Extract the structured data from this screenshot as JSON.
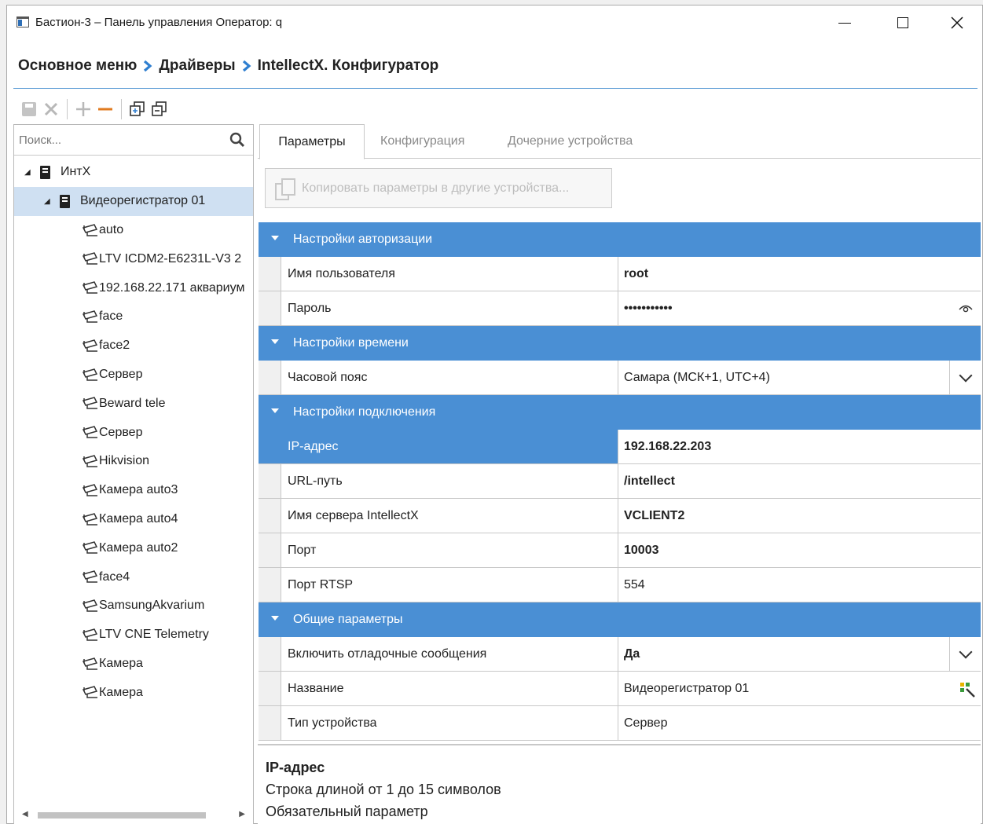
{
  "window": {
    "title": "Бастион-3 – Панель управления Оператор: q"
  },
  "breadcrumb": {
    "items": [
      "Основное меню",
      "Драйверы",
      "IntellectX. Конфигуратор"
    ]
  },
  "search": {
    "placeholder": "Поиск..."
  },
  "tree": {
    "root": "ИнтX",
    "device": "Видеорегистратор 01",
    "cameras": [
      "auto",
      "LTV ICDM2-E6231L-V3 2",
      "192.168.22.171 аквариум",
      "face",
      "face2",
      "Сервер",
      "Beward tele",
      "Сервер",
      "Hikvision",
      "Камера auto3",
      "Камера auto4",
      "Камера auto2",
      "face4",
      "SamsungAkvarium",
      "LTV CNE Telemetry",
      "Камера",
      "Камера"
    ]
  },
  "tabs": [
    "Параметры",
    "Конфигурация",
    "Дочерние устройства"
  ],
  "copy_button": "Копировать параметры в другие устройства...",
  "sections": {
    "auth": {
      "title": "Настройки авторизации",
      "username_label": "Имя пользователя",
      "username_value": "root",
      "password_label": "Пароль",
      "password_value": "•••••••••••"
    },
    "time": {
      "title": "Настройки времени",
      "tz_label": "Часовой пояс",
      "tz_value": "Самара (МСК+1, UTC+4)"
    },
    "connection": {
      "title": "Настройки подключения",
      "ip_label": "IP-адрес",
      "ip_value": "192.168.22.203",
      "url_label": "URL-путь",
      "url_value": "/intellect",
      "server_label": "Имя сервера IntellectX",
      "server_value": "VCLIENT2",
      "port_label": "Порт",
      "port_value": "10003",
      "rtsp_label": "Порт RTSP",
      "rtsp_value": "554"
    },
    "general": {
      "title": "Общие параметры",
      "debug_label": "Включить отладочные сообщения",
      "debug_value": "Да",
      "name_label": "Название",
      "name_value": "Видеорегистратор 01",
      "type_label": "Тип устройства",
      "type_value": "Сервер"
    }
  },
  "help": {
    "title": "IP-адрес",
    "line1": "Строка длиной от 1 до 15 символов",
    "line2": "Обязательный параметр"
  },
  "colors": {
    "accent": "#4a8fd4",
    "selection": "#cfe0f2",
    "minus": "#e07a1f"
  }
}
